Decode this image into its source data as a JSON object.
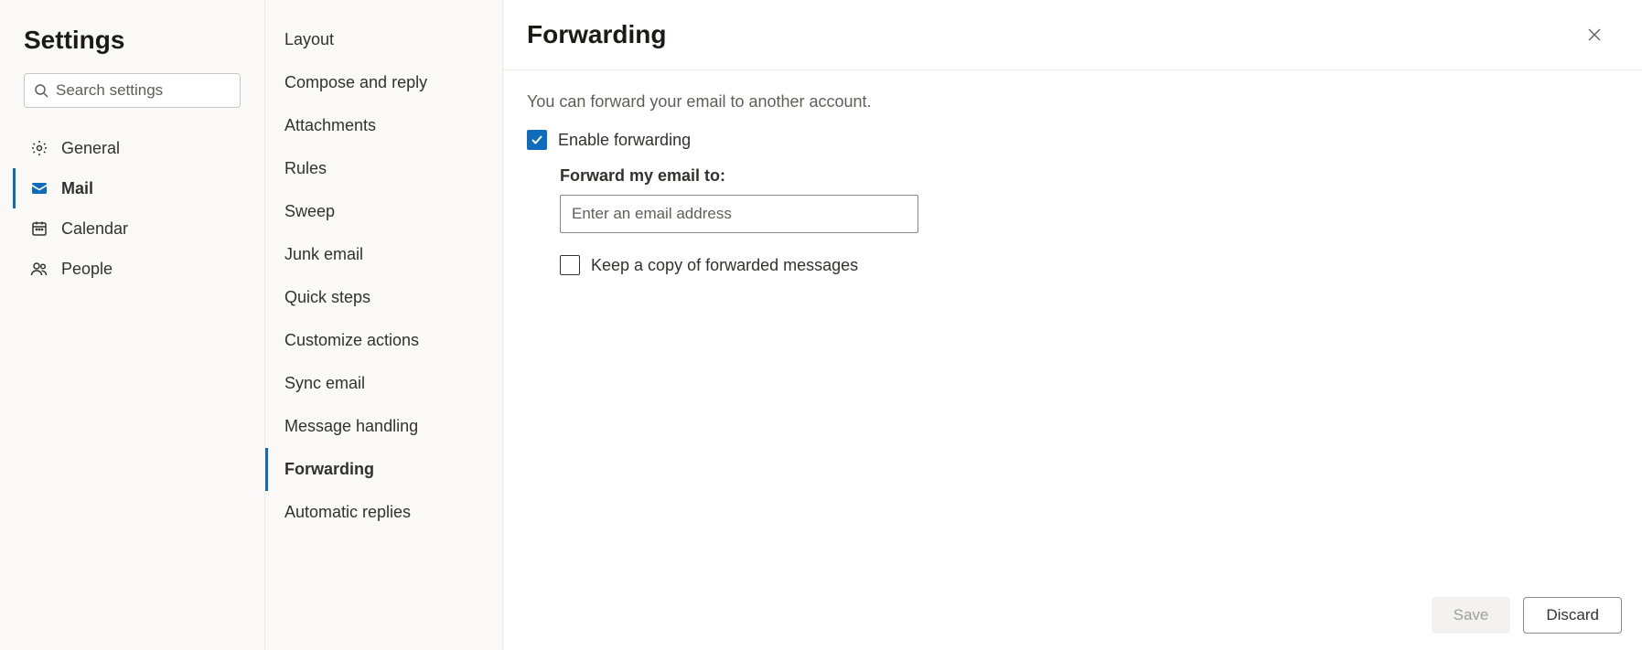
{
  "sidebar": {
    "title": "Settings",
    "search_placeholder": "Search settings",
    "categories": [
      {
        "id": "general",
        "label": "General",
        "icon": "gear"
      },
      {
        "id": "mail",
        "label": "Mail",
        "icon": "mail"
      },
      {
        "id": "calendar",
        "label": "Calendar",
        "icon": "calendar"
      },
      {
        "id": "people",
        "label": "People",
        "icon": "people"
      }
    ],
    "selected": "mail"
  },
  "subnav": {
    "items": [
      "Layout",
      "Compose and reply",
      "Attachments",
      "Rules",
      "Sweep",
      "Junk email",
      "Quick steps",
      "Customize actions",
      "Sync email",
      "Message handling",
      "Forwarding",
      "Automatic replies"
    ],
    "selected": "Forwarding"
  },
  "pane": {
    "title": "Forwarding",
    "description": "You can forward your email to another account.",
    "enable_label": "Enable forwarding",
    "enable_checked": true,
    "forward_to_label": "Forward my email to:",
    "forward_to_placeholder": "Enter an email address",
    "forward_to_value": "",
    "keep_copy_label": "Keep a copy of forwarded messages",
    "keep_copy_checked": false,
    "save_label": "Save",
    "discard_label": "Discard"
  }
}
